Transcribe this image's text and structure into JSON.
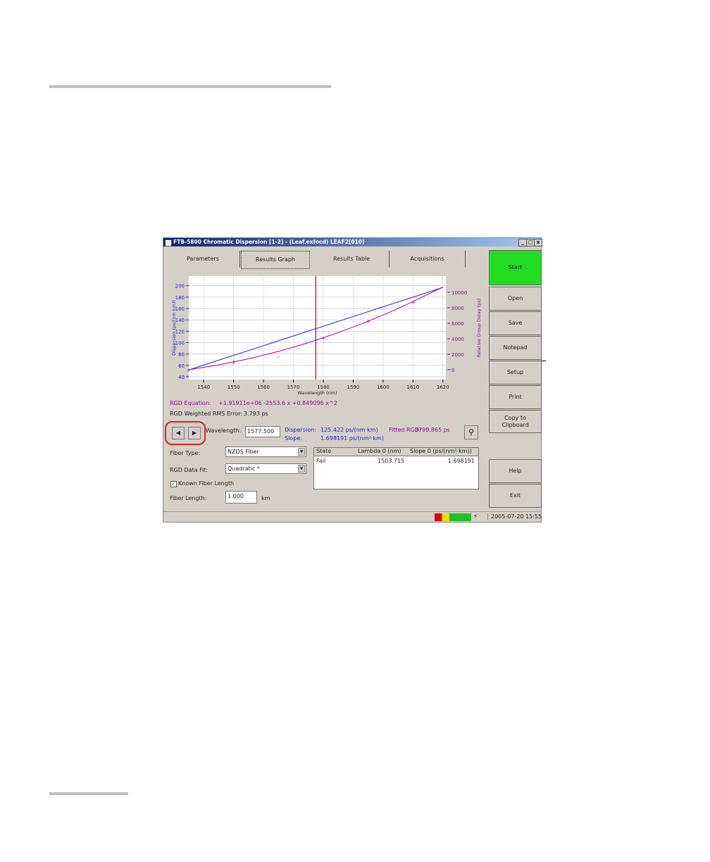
{
  "window": {
    "title": "FTB-5800 Chromatic Dispersion  [1-2] - (Leaf.exfocd) LEAF2[010]",
    "min": "_",
    "max": "□",
    "close": "x"
  },
  "tabs": [
    {
      "label": "Parameters"
    },
    {
      "label": "Results Graph",
      "selected": true
    },
    {
      "label": "Results Table"
    },
    {
      "label": "Acquisitions"
    }
  ],
  "buttons": {
    "start": "Start",
    "open": "Open",
    "save": "Save",
    "notepad": "Notepad",
    "setup": "Setup",
    "print": "Print",
    "copy": "Copy to Clipboard",
    "help": "Help",
    "exit": "Exit"
  },
  "colors": {
    "start": "#22dd22",
    "dispersion": "#2020d0",
    "rgd": "#a000a0",
    "cursor": "#d00000"
  },
  "chart_data": {
    "type": "line",
    "xlabel": "Wavelength (nm)",
    "ylabel_left": "Dispersion (ps/(nm·km))",
    "ylabel_right": "Relative Group Delay (ps)",
    "xlim": [
      1535,
      1621
    ],
    "ylim_left": [
      35,
      217
    ],
    "ylim_right": [
      -1273,
      12091
    ],
    "xticks": [
      1540,
      1550,
      1560,
      1570,
      1580,
      1590,
      1600,
      1610,
      1620
    ],
    "yticks_left": [
      40,
      60,
      80,
      100,
      120,
      140,
      160,
      180,
      200
    ],
    "yticks_right": [
      0,
      2000,
      4000,
      6000,
      8000,
      10000
    ],
    "grid": true,
    "series": [
      {
        "axis": "left",
        "x": [
          1535,
          1620
        ],
        "y": [
          52,
          197
        ]
      },
      {
        "axis": "right",
        "x": [
          1535,
          1545,
          1555,
          1565,
          1575,
          1585,
          1595,
          1605,
          1620
        ],
        "y": [
          4,
          621,
          1408,
          2365,
          3492,
          4788,
          6254,
          7891,
          10663
        ]
      }
    ],
    "rgd_points": {
      "x": [
        1535,
        1550,
        1580,
        1595,
        1610
      ],
      "y": [
        0,
        990,
        4110,
        6254,
        8750
      ]
    },
    "excluded_points": {
      "x": [
        1565
      ],
      "y": [
        1727
      ]
    },
    "cursor_x": 1577.5
  },
  "results": {
    "rgd_equation_label": "RGD Equation:",
    "rgd_equation": "+1.91911e+06 -2553.6 x +0.849096 x^2",
    "rms_label": "RGD Weighted RMS Error:",
    "rms": "3.793 ps",
    "wavelength_label": "Wavelength:",
    "wavelength": "1577.500",
    "dispersion_label": "Dispersion:",
    "dispersion": "125.422 ps/(nm·km)",
    "slope_label": "Slope:",
    "slope": "1.698191 ps/(nm²·km)",
    "fitted_label": "Fitted RGD:",
    "fitted": "3799.865 ps"
  },
  "form": {
    "fiber_type_label": "Fiber Type:",
    "fiber_type": "NZDS Fiber",
    "fit_label": "RGD Data Fit:",
    "fit": "Quadratic *",
    "known_length": "Known Fiber Length",
    "length_label": "Fiber Length:",
    "length": "1.000",
    "unit": "km"
  },
  "table": {
    "headers": [
      "State",
      "Lambda  0 (nm)",
      "Slope 0 (ps/(nm²·km))"
    ],
    "rows": [
      [
        "Fail",
        "1503.715",
        "1.698191"
      ]
    ]
  },
  "status": {
    "datetime": "2005-07-20 15:55"
  }
}
